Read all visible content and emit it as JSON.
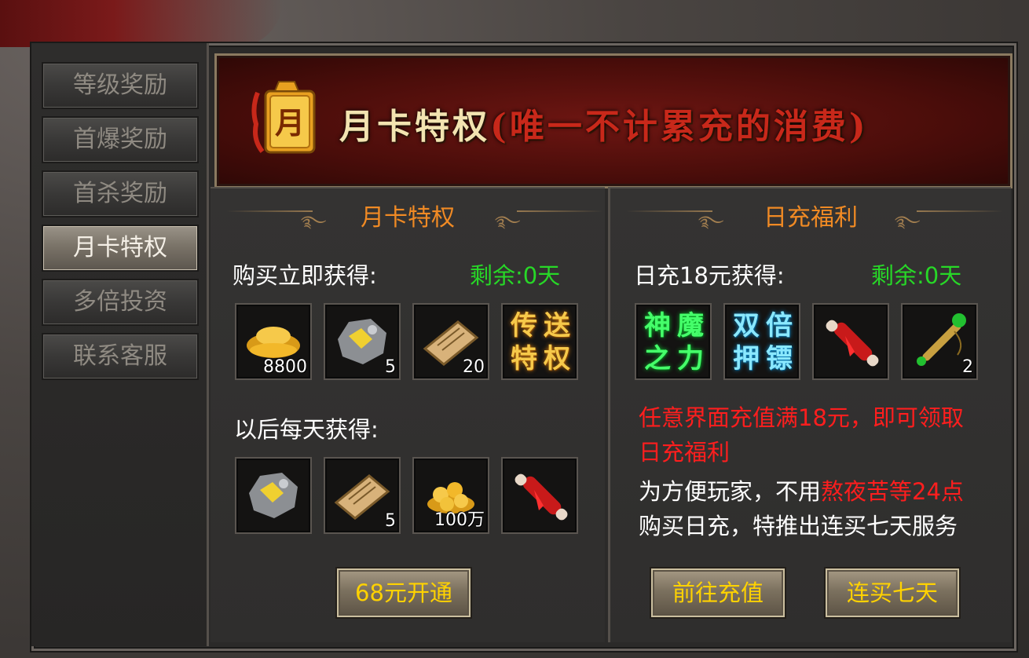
{
  "sidebar": {
    "items": [
      {
        "label": "等级奖励",
        "active": false
      },
      {
        "label": "首爆奖励",
        "active": false
      },
      {
        "label": "首杀奖励",
        "active": false
      },
      {
        "label": "月卡特权",
        "active": true
      },
      {
        "label": "多倍投资",
        "active": false
      },
      {
        "label": "联系客服",
        "active": false
      }
    ]
  },
  "banner": {
    "badge_char": "月",
    "title": "月卡特权",
    "paren_text": "(唯一不计累充的消费)"
  },
  "left": {
    "heading": "月卡特权",
    "buy_label": "购买立即获得:",
    "remain": "剩余:0天",
    "buy_items": [
      {
        "icon": "gold-ingot-icon",
        "qty": "8800"
      },
      {
        "icon": "ore-icon",
        "qty": "5"
      },
      {
        "icon": "scroll-icon",
        "qty": "20"
      },
      {
        "icon": "teleport-privilege-icon",
        "text": [
          "传",
          "送",
          "特",
          "权"
        ]
      }
    ],
    "daily_label": "以后每天获得:",
    "daily_items": [
      {
        "icon": "ore-icon",
        "qty": ""
      },
      {
        "icon": "scroll-icon",
        "qty": "5"
      },
      {
        "icon": "gold-coins-icon",
        "qty": "100万"
      },
      {
        "icon": "red-scroll-icon",
        "qty": ""
      }
    ],
    "button": "68元开通"
  },
  "right": {
    "heading": "日充福利",
    "buy_label": "日充18元获得:",
    "remain": "剩余:0天",
    "items": [
      {
        "icon": "divine-power-icon",
        "text": [
          "神",
          "魔",
          "之",
          "力"
        ]
      },
      {
        "icon": "double-escort-icon",
        "text": [
          "双",
          "倍",
          "押",
          "镖"
        ]
      },
      {
        "icon": "red-scroll-icon",
        "qty": ""
      },
      {
        "icon": "green-staff-icon",
        "qty": "2"
      }
    ],
    "desc_line1": "任意界面充值满18元，即可领取",
    "desc_line2": "日充福利",
    "desc_line3a": "为方便玩家，不用",
    "desc_line3b": "熬夜苦等24点",
    "desc_line4": "购买日充，特推出连买七天服务",
    "button1": "前往充值",
    "button2": "连买七天"
  },
  "colors": {
    "accent_orange": "#f08a24",
    "remain_green": "#27d827",
    "button_text": "#ffd200",
    "alert_red": "#ff1e1e"
  }
}
